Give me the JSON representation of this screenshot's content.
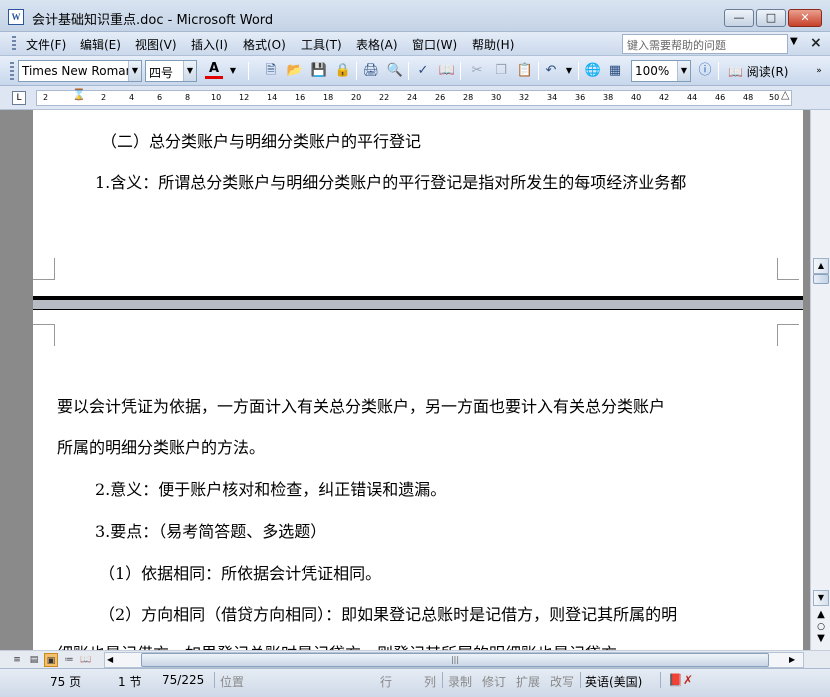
{
  "window": {
    "title": "会计基础知识重点.doc - Microsoft Word",
    "app_icon": "W",
    "min_icon": "minimize-icon",
    "max_icon": "maximize-icon",
    "close_icon": "close-icon"
  },
  "menu": {
    "items": [
      "文件(F)",
      "编辑(E)",
      "视图(V)",
      "插入(I)",
      "格式(O)",
      "工具(T)",
      "表格(A)",
      "窗口(W)",
      "帮助(H)"
    ],
    "help_placeholder": "键入需要帮助的问题"
  },
  "toolbar": {
    "font_name": "Times New Roman",
    "font_size": "四号",
    "zoom": "100%",
    "read_mode_label": "阅读(R)"
  },
  "ruler": {
    "ticks": [
      "2",
      "2",
      "4",
      "6",
      "8",
      "10",
      "12",
      "14",
      "16",
      "18",
      "20",
      "22",
      "24",
      "26",
      "28",
      "30",
      "32",
      "34",
      "36",
      "38",
      "40",
      "42",
      "44",
      "46",
      "48",
      "50"
    ]
  },
  "document": {
    "page1": {
      "lines": [
        "（二）总分类账户与明细分类账户的平行登记",
        "1.含义：所谓总分类账户与明细分类账户的平行登记是指对所发生的每项经济业务都"
      ]
    },
    "page2": {
      "lines": [
        "要以会计凭证为依据，一方面计入有关总分类账户，另一方面也要计入有关总分类账户",
        "所属的明细分类账户的方法。",
        "2.意义：便于账户核对和检查，纠正错误和遗漏。",
        "3.要点：（易考简答题、多选题）",
        "（1）依据相同：所依据会计凭证相同。",
        "（2）方向相同（借贷方向相同）：即如果登记总账时是记借方，则登记其所属的明",
        "细账也是记借方，如果登记总账时是记贷方，则登记其所属的明细账也是记贷方。"
      ]
    }
  },
  "status": {
    "page": "75 页",
    "section": "1 节",
    "pages": "75/225",
    "position": "位置",
    "line": "行",
    "column": "列",
    "rec": "录制",
    "track": "修订",
    "ext": "扩展",
    "ovr": "改写",
    "language": "英语(美国)"
  }
}
